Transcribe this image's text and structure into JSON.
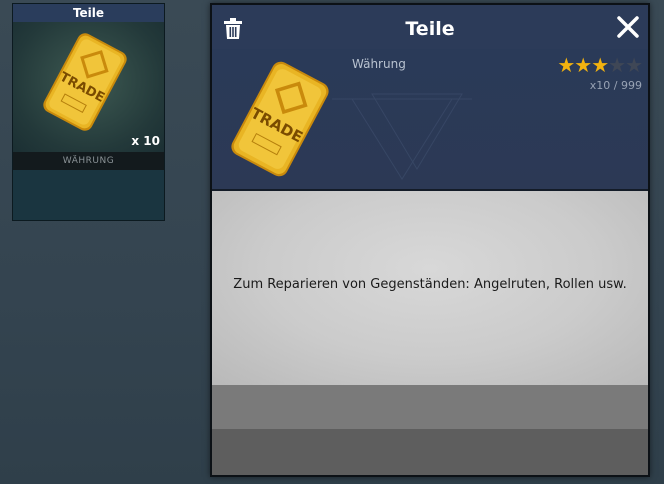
{
  "inventory_card": {
    "title": "Teile",
    "quantity": "x 10",
    "category": "WÄHRUNG",
    "icon": "trade-token-icon"
  },
  "detail_panel": {
    "title": "Teile",
    "category": "Währung",
    "rating_stars_filled": 3,
    "rating_stars_total": 5,
    "rating_filled": "★★★",
    "rating_empty": "★★",
    "count": "x10 / 999",
    "description": "Zum Reparieren von Gegenständen: Angelruten, Rollen usw.",
    "icons": {
      "trash": "trash-icon",
      "close": "close-icon",
      "item": "trade-token-icon"
    },
    "token_text": "TRADE"
  },
  "colors": {
    "header": "#2c3b59",
    "star": "#f2b20f",
    "token_gold": "#e8b21c"
  }
}
